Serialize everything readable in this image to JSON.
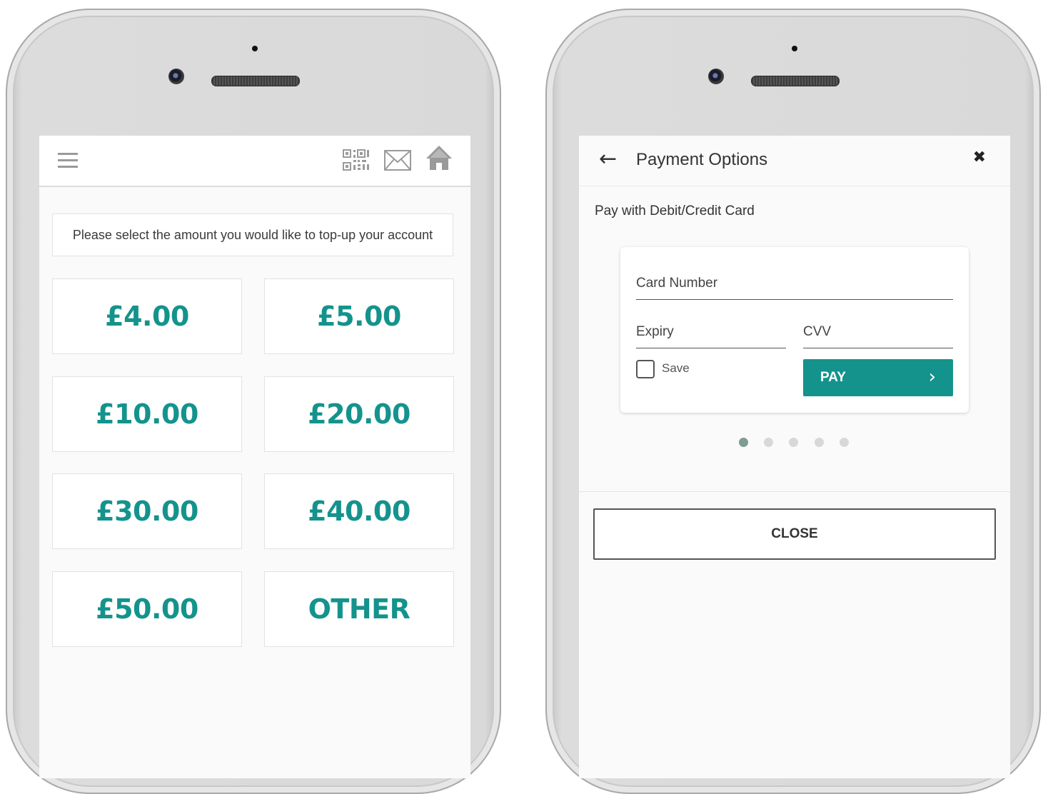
{
  "left_screen": {
    "prompt": "Please select the amount you would like to top-up your account",
    "icons": [
      "menu-icon",
      "qr-code-icon",
      "mail-icon",
      "home-icon"
    ],
    "amounts": [
      "£4.00",
      "£5.00",
      "£10.00",
      "£20.00",
      "£30.00",
      "£40.00",
      "£50.00",
      "OTHER"
    ]
  },
  "right_screen": {
    "title": "Payment Options",
    "back_icon": "arrow-left-icon",
    "close_icon": "close-icon",
    "subtitle": "Pay with Debit/Credit Card",
    "card_number_label": "Card Number",
    "expiry_label": "Expiry",
    "cvv_label": "CVV",
    "save_label": "Save",
    "save_checked": false,
    "pay_label": "PAY",
    "page_dots": 5,
    "active_dot": 1,
    "close_label": "CLOSE"
  },
  "colors": {
    "accent": "#14938d",
    "background": "#fafafa"
  }
}
